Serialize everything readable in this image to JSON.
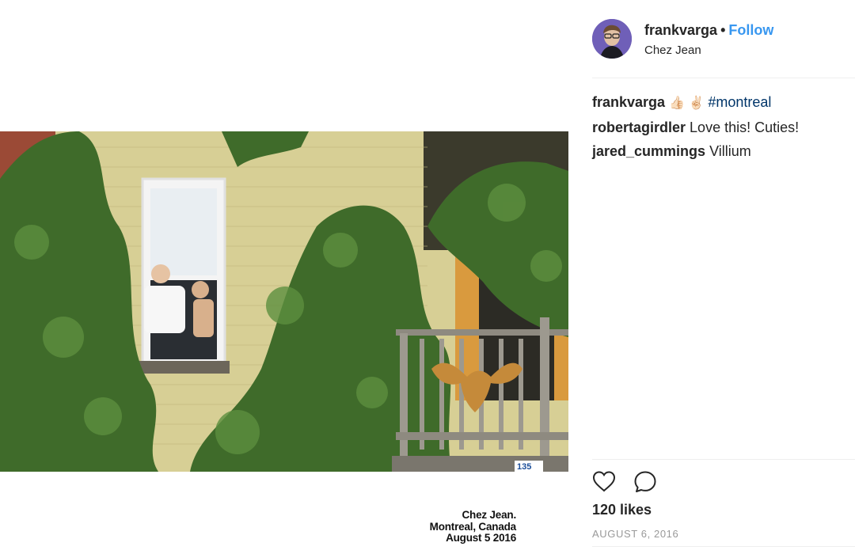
{
  "post": {
    "author": "frankvarga",
    "separator": "•",
    "follow_label": "Follow",
    "location": "Chez Jean",
    "likes": "120 likes",
    "date": "AUGUST 6, 2016"
  },
  "caption": {
    "line1": "Chez Jean.",
    "line2": "Montreal, Canada",
    "line3": "August 5 2016"
  },
  "photo": {
    "house_number": "135"
  },
  "comments": [
    {
      "user": "frankvarga",
      "emojis": "👍🏻 ✌🏻",
      "text": "#montreal"
    },
    {
      "user": "robertagirdler",
      "text": "Love this! Cuties!"
    },
    {
      "user": "jared_cummings",
      "text": "Villium"
    }
  ],
  "icons": {
    "like": "heart-outline-icon",
    "comment": "speech-bubble-icon"
  },
  "colors": {
    "link_blue": "#3897f0",
    "hashtag_blue": "#003569",
    "muted_gray": "#999999",
    "text": "#262626"
  }
}
